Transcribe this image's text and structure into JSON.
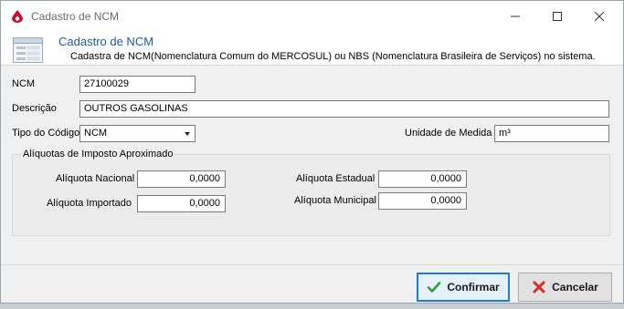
{
  "window": {
    "title": "Cadastro de NCM",
    "controls": {
      "minimize": "—",
      "maximize": "☐",
      "close": "✕"
    }
  },
  "header": {
    "title": "Cadastro de NCM",
    "subtitle": "Cadastra de NCM(Nomenclatura Comum do MERCOSUL) ou NBS (Nomenclatura Brasileira de Serviços) no sistema."
  },
  "form": {
    "ncm": {
      "label": "NCM",
      "value": "27100029"
    },
    "descricao": {
      "label": "Descrição",
      "value": "OUTROS GASOLINAS"
    },
    "tipo_codigo": {
      "label": "Tipo do Código",
      "value": "NCM"
    },
    "unidade_medida": {
      "label": "Unidade de Medida",
      "value": "m³"
    }
  },
  "aliquotas": {
    "title": "Alíquotas de Imposto Aproximado",
    "nacional": {
      "label": "Alíquota Nacional",
      "value": "0,0000"
    },
    "importado": {
      "label": "Alíquota Importado",
      "value": "0,0000"
    },
    "estadual": {
      "label": "Alíquota Estadual",
      "value": "0,0000"
    },
    "municipal": {
      "label": "Alíquota Municipal",
      "value": "0,0000"
    }
  },
  "buttons": {
    "confirmar": "Confirmar",
    "cancelar": "Cancelar"
  },
  "colors": {
    "header_title": "#1b5aa4",
    "confirm_border": "#1f7ad6",
    "check_green": "#2e9e3a",
    "cancel_red": "#d42a2a"
  }
}
